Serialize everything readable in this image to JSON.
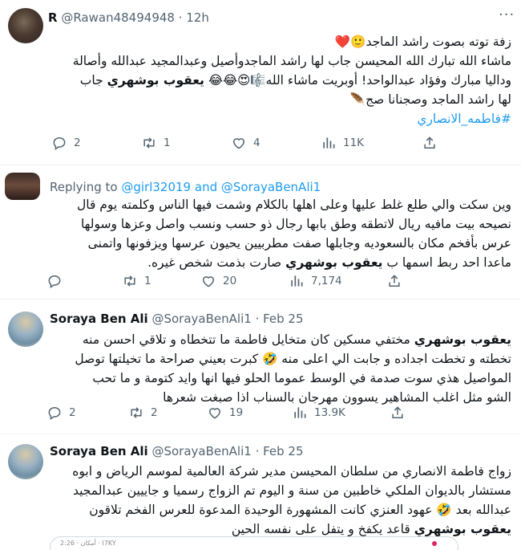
{
  "tweets": [
    {
      "name": "R",
      "handle": "@Rawan48494948",
      "time": "· 12h",
      "lines": [
        "زفة توته بصوت راشد الماجد🙂❤️",
        "ماشاء الله تبارك الله المحيسن جاب لها راشد الماجدوأصيل وعبدالمجيد عبدالله وأصالة",
        "وداليا مبارك وفؤاد عبدالواحد! أوبريت ماشاء الله🎼😍😂😂 يعقوب بوشهري جاب",
        "لها راشد الماجد وصجنانا صج🪶"
      ],
      "hashtag": "#فاطمه_الانصاري",
      "stats": {
        "replies": "2",
        "retweets": "1",
        "likes": "4",
        "views": "11K"
      }
    },
    {
      "replying_prefix": "Replying to",
      "replying_mention1": "@girl32019",
      "replying_and": "and",
      "replying_mention2": "@SorayaBenAli1",
      "lines": [
        "وين سكت والي طلع غلط عليها وعلى اهلها بالكلام وشمت فيها الناس وكلمته يوم قال",
        "نصيحه بيت مافيه ريال لاتطقه وطق بابها رجال ذو حسب ونسب واصل وعزها وسولها",
        "عرس بأفخم مكان بالسعوديه وجابلها صفت مطربيين يحيون عرسها ويزفونها واتمنى",
        "ماعدا احد ربط اسمها ب يعقوب بوشهري صارت بذمت شخص غيره."
      ],
      "stats": {
        "replies": "",
        "retweets": "1",
        "likes": "20",
        "views": "7,174"
      }
    },
    {
      "name": "Soraya Ben Ali",
      "handle": "@SorayaBenAli1",
      "time": "· Feb 25",
      "lines": [
        "يعقوب بوشهري مختفي مسكين كان متخايل فاطمة ما تتخطاه و تلاقي احسن منه",
        "تخطته و تخطت اجداده و جابت الي اعلى منه 🤣 كبرت بعيني صراحة ما تخيلتها توصل",
        "المواصيل هذي سوت صدمة في الوسط عموما الحلو فيها انها وايد كتومة و ما تحب",
        "الشو مثل اغلب المشاهير يسوون مهرجان بالسناب اذا صبغت شعرها"
      ],
      "stats": {
        "replies": "2",
        "retweets": "2",
        "likes": "19",
        "views": "13.9K"
      }
    },
    {
      "name": "Soraya Ben Ali",
      "handle": "@SorayaBenAli1",
      "time": "· Feb 25",
      "lines": [
        "زواج فاطمة الانصاري من سلطان المحيسن مدير شركة العالمية لموسم الرياض و ابوه",
        "مستشار بالديوان الملكي خاطبين من سنة و اليوم تم الزواج رسميا و جاييين عبدالمجيد",
        "عبدالله بعد 🤣 عهود العنزي كانت المشهورة الوحيدة المدعوة للعرس الفخم تلاقون",
        "يعقوب بوشهري قاعد يكفخ و يتفل على نفسه الحين"
      ],
      "embed_text": "أمكان · 2:26 · I7KY"
    }
  ],
  "icons": {
    "reply": "reply-icon",
    "retweet": "retweet-icon",
    "like": "heart-icon",
    "views": "views-icon",
    "share": "share-icon",
    "more": "more-icon"
  },
  "colors": {
    "accent": "#1d9bf0",
    "muted": "#536471",
    "divider": "#eff3f4"
  }
}
